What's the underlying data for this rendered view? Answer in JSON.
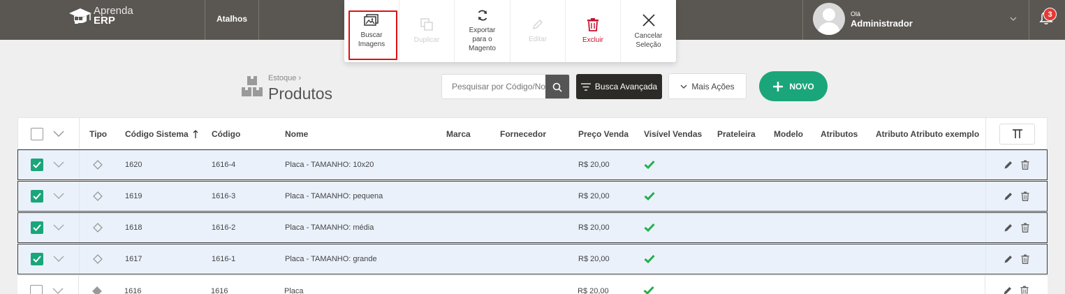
{
  "header": {
    "logo_line1": "Aprenda",
    "logo_line2": "ERP",
    "atalhos": "Atalhos",
    "user_greeting": "Olá",
    "user_name": "Administrador",
    "notification_count": "3"
  },
  "actions": [
    {
      "label_lines": [
        "Buscar",
        "Imagens"
      ],
      "icon": "images-icon",
      "state": "selected"
    },
    {
      "label_lines": [
        "Duplicar"
      ],
      "icon": "duplicate-icon",
      "state": "disabled"
    },
    {
      "label_lines": [
        "Exportar",
        "para o",
        "Magento"
      ],
      "icon": "sync-icon",
      "state": "normal"
    },
    {
      "label_lines": [
        "Editar"
      ],
      "icon": "pencil-icon",
      "state": "disabled"
    },
    {
      "label_lines": [
        "Excluir"
      ],
      "icon": "trash-icon",
      "state": "danger"
    },
    {
      "label_lines": [
        "Cancelar",
        "Seleção"
      ],
      "icon": "close-icon",
      "state": "normal"
    }
  ],
  "page": {
    "breadcrumb": "Estoque",
    "title": "Produtos",
    "search_placeholder": "Pesquisar por Código/Nome",
    "advanced_search": "Busca Avançada",
    "more_actions": "Mais Ações",
    "new_button": "NOVO"
  },
  "table": {
    "columns": [
      "Tipo",
      "Código Sistema",
      "Código",
      "Nome",
      "Marca",
      "Fornecedor",
      "Preço Venda",
      "Visível Vendas",
      "Prateleira",
      "Modelo",
      "Atributos",
      "Atributo Atributo exemplo"
    ],
    "sorted_column": "Código Sistema",
    "rows": [
      {
        "selected": true,
        "type": "variation",
        "codigo_sistema": "1620",
        "codigo": "1616-4",
        "nome": "Placa - TAMANHO: 10x20",
        "preco": "R$ 20,00",
        "visivel": true
      },
      {
        "selected": true,
        "type": "variation",
        "codigo_sistema": "1619",
        "codigo": "1616-3",
        "nome": "Placa - TAMANHO: pequena",
        "preco": "R$ 20,00",
        "visivel": true
      },
      {
        "selected": true,
        "type": "variation",
        "codigo_sistema": "1618",
        "codigo": "1616-2",
        "nome": "Placa - TAMANHO: média",
        "preco": "R$ 20,00",
        "visivel": true
      },
      {
        "selected": true,
        "type": "variation",
        "codigo_sistema": "1617",
        "codigo": "1616-1",
        "nome": "Placa - TAMANHO: grande",
        "preco": "R$ 20,00",
        "visivel": true
      },
      {
        "selected": false,
        "type": "parent",
        "codigo_sistema": "1616",
        "codigo": "1616",
        "nome": "Placa",
        "preco": "R$ 20,00",
        "visivel": true
      }
    ]
  },
  "colors": {
    "topbar": "#5a5752",
    "accent_green": "#1aa67a",
    "danger": "#c8102e",
    "selected_row": "#eaf1fb"
  }
}
